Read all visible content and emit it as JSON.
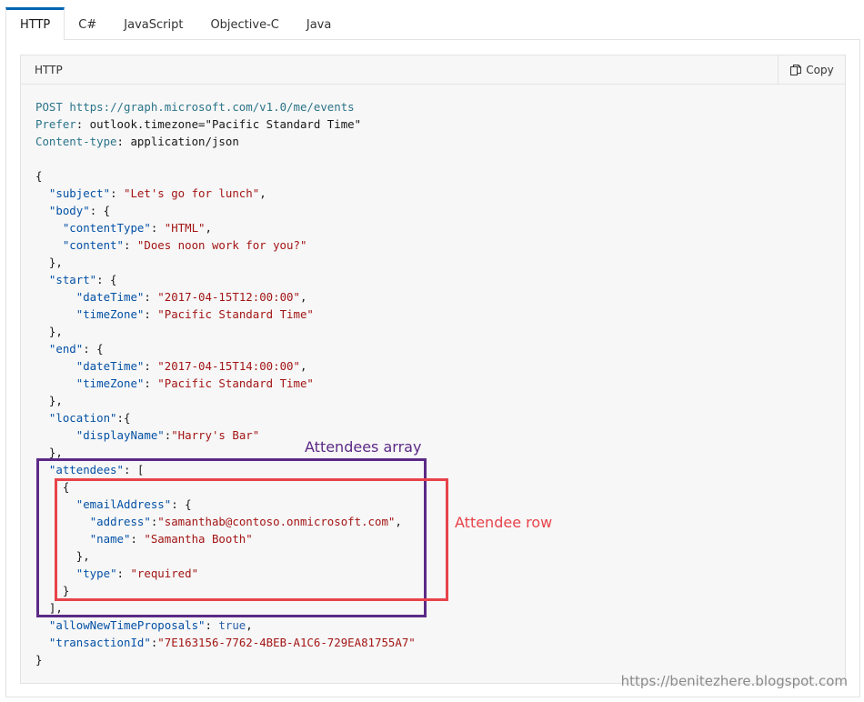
{
  "tabs": [
    "HTTP",
    "C#",
    "JavaScript",
    "Objective-C",
    "Java"
  ],
  "active_tab": "HTTP",
  "code_header": {
    "language": "HTTP",
    "copy_label": "Copy"
  },
  "code_lines": [
    [
      [
        "k",
        "POST"
      ],
      [
        "b",
        " "
      ],
      [
        "k",
        "https://graph.microsoft.com/v1.0/me/events"
      ]
    ],
    [
      [
        "k",
        "Prefer"
      ],
      [
        "b",
        ": outlook.timezone=\"Pacific Standard Time\""
      ]
    ],
    [
      [
        "k",
        "Content-type"
      ],
      [
        "b",
        ": application/json"
      ]
    ],
    [
      [
        "b",
        ""
      ]
    ],
    [
      [
        "b",
        "{"
      ]
    ],
    [
      [
        "b",
        "  "
      ],
      [
        "kk",
        "\"subject\""
      ],
      [
        "b",
        ": "
      ],
      [
        "s",
        "\"Let's go for lunch\""
      ],
      [
        "b",
        ","
      ]
    ],
    [
      [
        "b",
        "  "
      ],
      [
        "kk",
        "\"body\""
      ],
      [
        "b",
        ": {"
      ]
    ],
    [
      [
        "b",
        "    "
      ],
      [
        "kk",
        "\"contentType\""
      ],
      [
        "b",
        ": "
      ],
      [
        "s",
        "\"HTML\""
      ],
      [
        "b",
        ","
      ]
    ],
    [
      [
        "b",
        "    "
      ],
      [
        "kk",
        "\"content\""
      ],
      [
        "b",
        ": "
      ],
      [
        "s",
        "\"Does noon work for you?\""
      ]
    ],
    [
      [
        "b",
        "  },"
      ]
    ],
    [
      [
        "b",
        "  "
      ],
      [
        "kk",
        "\"start\""
      ],
      [
        "b",
        ": {"
      ]
    ],
    [
      [
        "b",
        "      "
      ],
      [
        "kk",
        "\"dateTime\""
      ],
      [
        "b",
        ": "
      ],
      [
        "s",
        "\"2017-04-15T12:00:00\""
      ],
      [
        "b",
        ","
      ]
    ],
    [
      [
        "b",
        "      "
      ],
      [
        "kk",
        "\"timeZone\""
      ],
      [
        "b",
        ": "
      ],
      [
        "s",
        "\"Pacific Standard Time\""
      ]
    ],
    [
      [
        "b",
        "  },"
      ]
    ],
    [
      [
        "b",
        "  "
      ],
      [
        "kk",
        "\"end\""
      ],
      [
        "b",
        ": {"
      ]
    ],
    [
      [
        "b",
        "      "
      ],
      [
        "kk",
        "\"dateTime\""
      ],
      [
        "b",
        ": "
      ],
      [
        "s",
        "\"2017-04-15T14:00:00\""
      ],
      [
        "b",
        ","
      ]
    ],
    [
      [
        "b",
        "      "
      ],
      [
        "kk",
        "\"timeZone\""
      ],
      [
        "b",
        ": "
      ],
      [
        "s",
        "\"Pacific Standard Time\""
      ]
    ],
    [
      [
        "b",
        "  },"
      ]
    ],
    [
      [
        "b",
        "  "
      ],
      [
        "kk",
        "\"location\""
      ],
      [
        "b",
        ":{"
      ]
    ],
    [
      [
        "b",
        "      "
      ],
      [
        "kk",
        "\"displayName\""
      ],
      [
        "b",
        ":"
      ],
      [
        "s",
        "\"Harry's Bar\""
      ]
    ],
    [
      [
        "b",
        "  },"
      ]
    ],
    [
      [
        "b",
        "  "
      ],
      [
        "kk",
        "\"attendees\""
      ],
      [
        "b",
        ": ["
      ]
    ],
    [
      [
        "b",
        "    {"
      ]
    ],
    [
      [
        "b",
        "      "
      ],
      [
        "kk",
        "\"emailAddress\""
      ],
      [
        "b",
        ": {"
      ]
    ],
    [
      [
        "b",
        "        "
      ],
      [
        "kk",
        "\"address\""
      ],
      [
        "b",
        ":"
      ],
      [
        "s",
        "\"samanthab@contoso.onmicrosoft.com\""
      ],
      [
        "b",
        ","
      ]
    ],
    [
      [
        "b",
        "        "
      ],
      [
        "kk",
        "\"name\""
      ],
      [
        "b",
        ": "
      ],
      [
        "s",
        "\"Samantha Booth\""
      ]
    ],
    [
      [
        "b",
        "      },"
      ]
    ],
    [
      [
        "b",
        "      "
      ],
      [
        "kk",
        "\"type\""
      ],
      [
        "b",
        ": "
      ],
      [
        "s",
        "\"required\""
      ]
    ],
    [
      [
        "b",
        "    }"
      ]
    ],
    [
      [
        "b",
        "  ],"
      ]
    ],
    [
      [
        "b",
        "  "
      ],
      [
        "kk",
        "\"allowNewTimeProposals\""
      ],
      [
        "b",
        ": "
      ],
      [
        "kx",
        "true"
      ],
      [
        "b",
        ","
      ]
    ],
    [
      [
        "b",
        "  "
      ],
      [
        "kk",
        "\"transactionId\""
      ],
      [
        "b",
        ":"
      ],
      [
        "s",
        "\"7E163156-7762-4BEB-A1C6-729EA81755A7\""
      ]
    ],
    [
      [
        "b",
        "}"
      ]
    ]
  ],
  "annotations": {
    "attendees_array": {
      "label": "Attendees array",
      "color": "#5b2a86"
    },
    "attendee_row": {
      "label": "Attendee row",
      "color": "#e8434b"
    }
  },
  "watermark": "https://benitezhere.blogspot.com"
}
